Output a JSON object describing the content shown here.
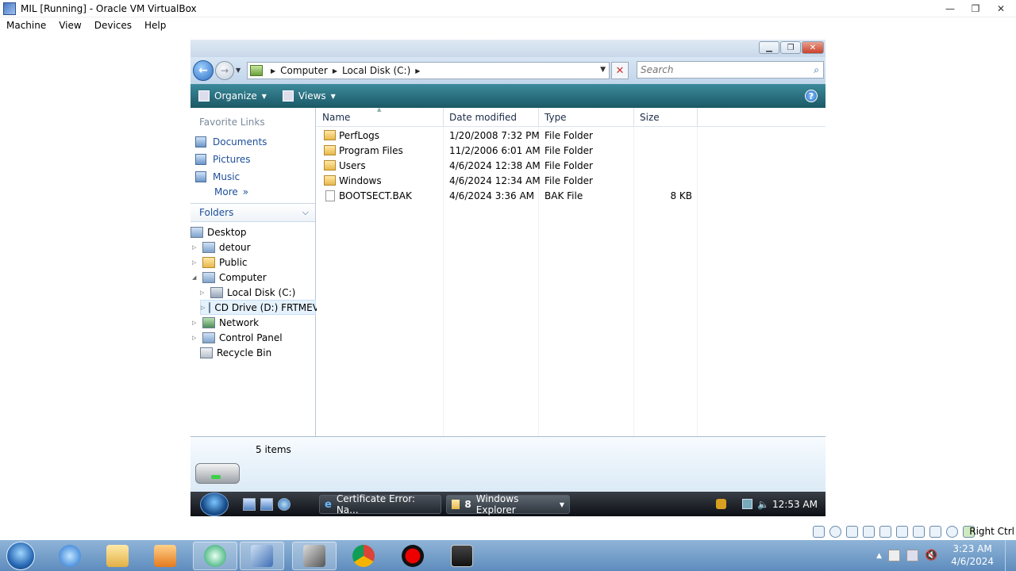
{
  "host": {
    "title": "MIL [Running] - Oracle VM VirtualBox",
    "menu": [
      "Machine",
      "View",
      "Devices",
      "Help"
    ],
    "status_key": "Right Ctrl",
    "taskbar_time": "3:23 AM",
    "taskbar_date": "4/6/2024"
  },
  "explorer": {
    "address": [
      "Computer",
      "Local Disk (C:)"
    ],
    "search_placeholder": "Search",
    "toolbar": {
      "organize": "Organize",
      "views": "Views"
    },
    "favorites_title": "Favorite Links",
    "favorites": [
      "Documents",
      "Pictures",
      "Music"
    ],
    "more": "More",
    "folders_title": "Folders",
    "tree": [
      {
        "label": "Desktop",
        "icon": "desktop-icon"
      },
      {
        "label": "detour",
        "icon": "user-folder-icon"
      },
      {
        "label": "Public",
        "icon": "folder-icon"
      },
      {
        "label": "Computer",
        "icon": "computer-icon"
      },
      {
        "label": "Local Disk (C:)",
        "icon": "disk-icon"
      },
      {
        "label": "CD Drive (D:) FRTMEV",
        "icon": "cd-icon"
      },
      {
        "label": "Network",
        "icon": "network-icon"
      },
      {
        "label": "Control Panel",
        "icon": "control-panel-icon"
      },
      {
        "label": "Recycle Bin",
        "icon": "recycle-bin-icon"
      }
    ],
    "columns": [
      "Name",
      "Date modified",
      "Type",
      "Size"
    ],
    "files": [
      {
        "name": "PerfLogs",
        "date": "1/20/2008 7:32 PM",
        "type": "File Folder",
        "size": ""
      },
      {
        "name": "Program Files",
        "date": "11/2/2006 6:01 AM",
        "type": "File Folder",
        "size": ""
      },
      {
        "name": "Users",
        "date": "4/6/2024 12:38 AM",
        "type": "File Folder",
        "size": ""
      },
      {
        "name": "Windows",
        "date": "4/6/2024 12:34 AM",
        "type": "File Folder",
        "size": ""
      },
      {
        "name": "BOOTSECT.BAK",
        "date": "4/6/2024 3:36 AM",
        "type": "BAK File",
        "size": "8 KB"
      }
    ],
    "items_count": "5 items"
  },
  "guest_taskbar": {
    "task1": "Certificate Error: Na...",
    "task2_count": "8",
    "task2_label": "Windows Explorer",
    "clock": "12:53 AM"
  }
}
